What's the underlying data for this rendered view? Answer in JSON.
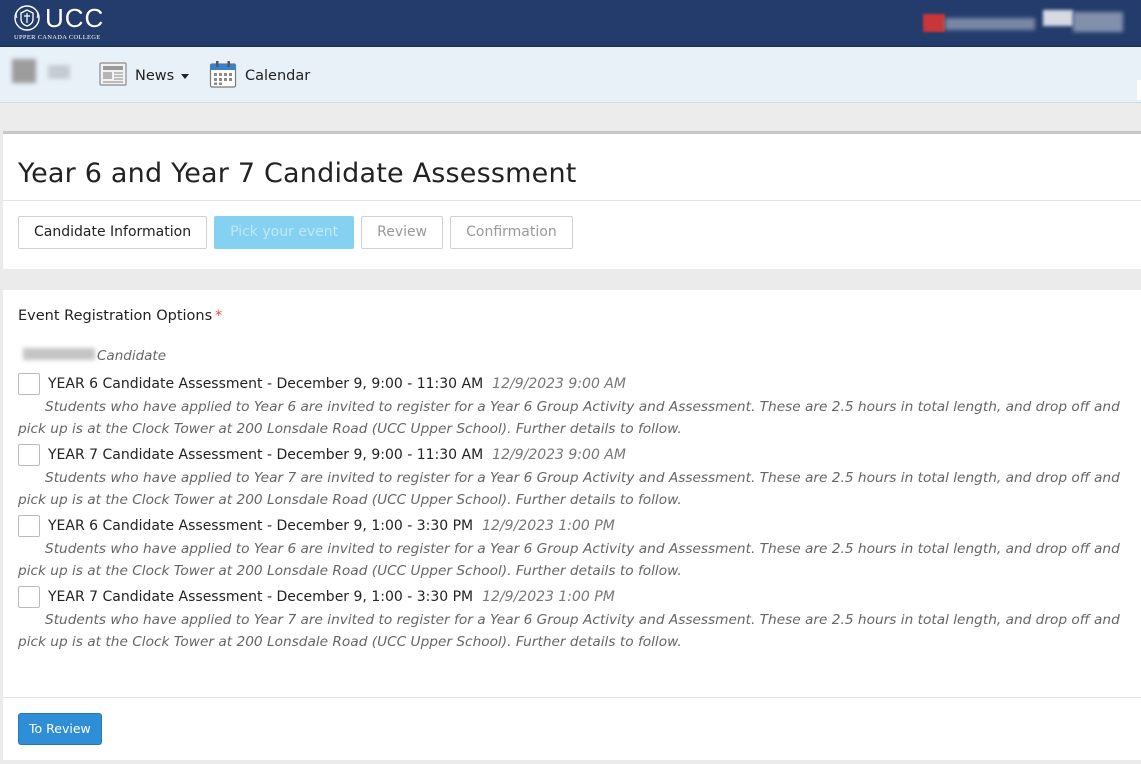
{
  "header": {
    "logo_text": "UCC",
    "logo_subtitle": "UPPER CANADA COLLEGE",
    "crest_icon": "crest-icon"
  },
  "nav": {
    "news_label": "News",
    "news_icon": "newspaper-icon",
    "calendar_label": "Calendar",
    "calendar_icon": "calendar-icon"
  },
  "page": {
    "title": "Year 6 and Year 7 Candidate Assessment"
  },
  "steps": [
    {
      "label": "Candidate Information",
      "state": "done"
    },
    {
      "label": "Pick your event",
      "state": "active"
    },
    {
      "label": "Review",
      "state": "pending"
    },
    {
      "label": "Confirmation",
      "state": "pending"
    }
  ],
  "form": {
    "field_label": "Event Registration Options",
    "required_mark": "*",
    "candidate_label": "Candidate",
    "options": [
      {
        "title": "YEAR 6 Candidate Assessment - December 9, 9:00 - 11:30 AM",
        "date": "12/9/2023 9:00 AM",
        "description": "Students who have applied to Year 6 are invited to register for a Year 6 Group Activity and Assessment. These are 2.5 hours in total length, and drop off and pick up is at the Clock Tower at 200 Lonsdale Road (UCC Upper School). Further details to follow.",
        "checked": false
      },
      {
        "title": "YEAR 7 Candidate Assessment - December 9, 9:00 - 11:30 AM",
        "date": "12/9/2023 9:00 AM",
        "description": "Students who have applied to Year 7 are invited to register for a Year 6 Group Activity and Assessment. These are 2.5 hours in total length, and drop off and pick up is at the Clock Tower at 200 Lonsdale Road (UCC Upper School). Further details to follow.",
        "checked": false
      },
      {
        "title": "YEAR 6 Candidate Assessment - December 9, 1:00 - 3:30 PM",
        "date": "12/9/2023 1:00 PM",
        "description": "Students who have applied to Year 6 are invited to register for a Year 6 Group Activity and Assessment. These are 2.5 hours in total length, and drop off and pick up is at the Clock Tower at 200 Lonsdale Road (UCC Upper School). Further details to follow.",
        "checked": false
      },
      {
        "title": "YEAR 7 Candidate Assessment - December 9, 1:00 - 3:30 PM",
        "date": "12/9/2023 1:00 PM",
        "description": "Students who have applied to Year 7 are invited to register for a Year 6 Group Activity and Assessment. These are 2.5 hours in total length, and drop off and pick up is at the Clock Tower at 200 Lonsdale Road (UCC Upper School). Further details to follow.",
        "checked": false
      }
    ],
    "submit_label": "To Review"
  },
  "colors": {
    "header_bg": "#243c6c",
    "nav_bg": "#e8f1f8",
    "active_step": "#84d1f1",
    "primary_button": "#2f8fd6",
    "required": "#d9534f"
  }
}
